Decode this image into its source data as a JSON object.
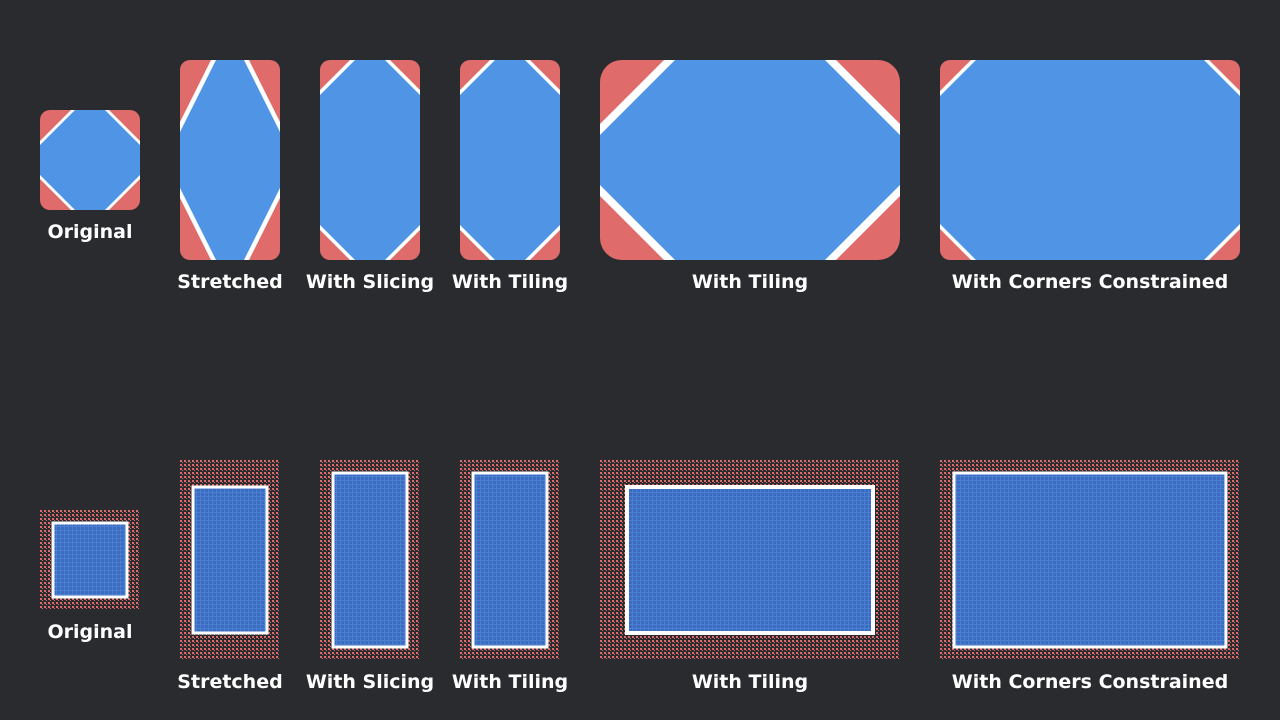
{
  "colors": {
    "background": "#2a2b2f",
    "red": "#e06b6b",
    "blue": "#5094e6",
    "blue_dark": "#3b6cc1",
    "white": "#ffffff"
  },
  "row1": {
    "labels": [
      "Original",
      "Stretched",
      "With Slicing",
      "With Tiling",
      "With Tiling",
      "With Corners Constrained"
    ]
  },
  "row2": {
    "labels": [
      "Original",
      "Stretched",
      "With Slicing",
      "With Tiling",
      "With Tiling",
      "With Corners Constrained"
    ]
  }
}
